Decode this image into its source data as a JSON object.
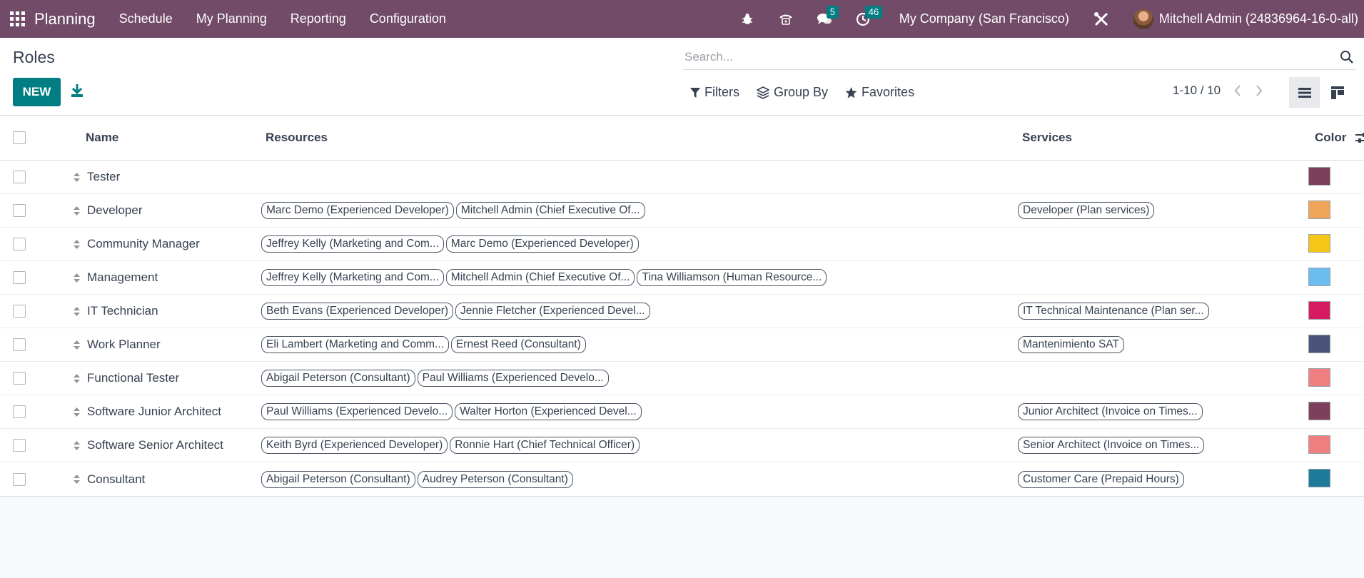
{
  "navbar": {
    "brand": "Planning",
    "menu": [
      "Schedule",
      "My Planning",
      "Reporting",
      "Configuration"
    ],
    "messages_count": "5",
    "activities_count": "46",
    "company": "My Company (San Francisco)",
    "user": "Mitchell Admin (24836964-16-0-all)"
  },
  "control": {
    "title": "Roles",
    "new_label": "NEW",
    "search_placeholder": "Search...",
    "filters_label": "Filters",
    "groupby_label": "Group By",
    "favorites_label": "Favorites",
    "pager": "1-10 / 10"
  },
  "table": {
    "headers": {
      "name": "Name",
      "resources": "Resources",
      "services": "Services",
      "color": "Color"
    },
    "rows": [
      {
        "name": "Tester",
        "resources": [],
        "services": [],
        "color": "#7c3f5c"
      },
      {
        "name": "Developer",
        "resources": [
          "Marc Demo (Experienced Developer)",
          "Mitchell Admin (Chief Executive Of..."
        ],
        "services": [
          "Developer (Plan services)"
        ],
        "color": "#efa55a"
      },
      {
        "name": "Community Manager",
        "resources": [
          "Jeffrey Kelly (Marketing and Com...",
          "Marc Demo (Experienced Developer)"
        ],
        "services": [],
        "color": "#f5c518"
      },
      {
        "name": "Management",
        "resources": [
          "Jeffrey Kelly (Marketing and Com...",
          "Mitchell Admin (Chief Executive Of...",
          "Tina Williamson (Human Resource..."
        ],
        "services": [],
        "color": "#6bbdf0"
      },
      {
        "name": "IT Technician",
        "resources": [
          "Beth Evans (Experienced Developer)",
          "Jennie Fletcher (Experienced Devel..."
        ],
        "services": [
          "IT Technical Maintenance (Plan ser..."
        ],
        "color": "#d81b60"
      },
      {
        "name": "Work Planner",
        "resources": [
          "Eli Lambert (Marketing and Comm...",
          "Ernest Reed (Consultant)"
        ],
        "services": [
          "Mantenimiento SAT"
        ],
        "color": "#4a5478"
      },
      {
        "name": "Functional Tester",
        "resources": [
          "Abigail Peterson (Consultant)",
          "Paul Williams (Experienced Develo..."
        ],
        "services": [],
        "color": "#ef7f80"
      },
      {
        "name": "Software Junior Architect",
        "resources": [
          "Paul Williams (Experienced Develo...",
          "Walter Horton (Experienced Devel..."
        ],
        "services": [
          "Junior Architect (Invoice on Times..."
        ],
        "color": "#7c3f5c"
      },
      {
        "name": "Software Senior Architect",
        "resources": [
          "Keith Byrd (Experienced Developer)",
          "Ronnie Hart (Chief Technical Officer)"
        ],
        "services": [
          "Senior Architect (Invoice on Times..."
        ],
        "color": "#ef7f80"
      },
      {
        "name": "Consultant",
        "resources": [
          "Abigail Peterson (Consultant)",
          "Audrey Peterson (Consultant)"
        ],
        "services": [
          "Customer Care (Prepaid Hours)"
        ],
        "color": "#1e7b99"
      }
    ]
  }
}
